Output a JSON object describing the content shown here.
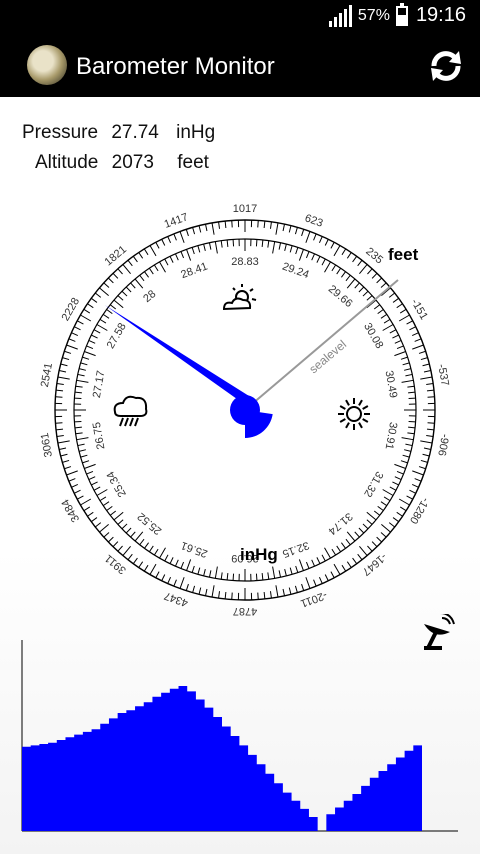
{
  "status_bar": {
    "battery": "57%",
    "time": "19:16"
  },
  "app": {
    "title": "Barometer Monitor",
    "refresh_icon": "refresh-icon",
    "app_icon": "barometer-icon"
  },
  "readings": {
    "pressure": {
      "label": "Pressure",
      "value": "27.74",
      "unit": "inHg"
    },
    "altitude": {
      "label": "Altitude",
      "value": "2073",
      "unit": "feet"
    }
  },
  "gauge": {
    "outer_unit": "feet",
    "inner_unit": "inHg",
    "sealevel_label": "sealevel",
    "outer_labels": [
      "1017",
      "623",
      "235",
      "-151",
      "-537",
      "-906",
      "-1280",
      "-1647",
      "-2011",
      "4787",
      "4347",
      "3911",
      "3484",
      "3061",
      "2541",
      "2228",
      "1821",
      "1417"
    ],
    "inner_labels": [
      "28.83",
      "29.24",
      "29.66",
      "30.08",
      "30.49",
      "30.91",
      "31.32",
      "31.74",
      "32.15",
      "26.09",
      "25.61",
      "25.52",
      "25.34",
      "26.75",
      "27.17",
      "27.58",
      "28",
      "28.41"
    ],
    "needle_value_inhg": 27.74,
    "weather_icons": [
      "partly-cloudy-icon",
      "storm-icon",
      "sun-icon"
    ],
    "colors": {
      "needle": "#0000ff",
      "chart_fill": "#0000ff",
      "sealevel_line": "#999999"
    }
  },
  "history_chart": {
    "type": "area",
    "color": "#0000ff",
    "values": [
      0.55,
      0.56,
      0.57,
      0.58,
      0.6,
      0.62,
      0.64,
      0.66,
      0.68,
      0.72,
      0.76,
      0.8,
      0.82,
      0.85,
      0.88,
      0.92,
      0.95,
      0.98,
      1.0,
      0.96,
      0.9,
      0.84,
      0.77,
      0.7,
      0.63,
      0.56,
      0.49,
      0.42,
      0.35,
      0.28,
      0.21,
      0.15,
      0.09,
      0.03,
      0.0,
      0.05,
      0.1,
      0.15,
      0.2,
      0.26,
      0.32,
      0.37,
      0.42,
      0.47,
      0.52,
      0.56
    ]
  },
  "icons": {
    "signal": "signal-icon",
    "battery": "battery-icon",
    "satellite": "satellite-dish-icon"
  }
}
